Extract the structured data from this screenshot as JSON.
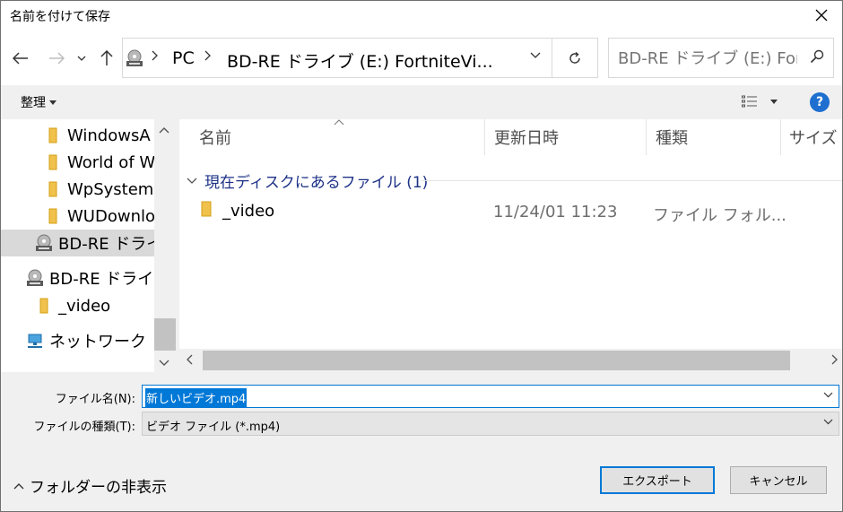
{
  "window": {
    "title": "名前を付けて保存"
  },
  "address": {
    "crumbs": [
      "PC",
      "BD-RE ドライブ (E:) FortniteVi..."
    ]
  },
  "search": {
    "placeholder": "BD-RE ドライブ (E:) Fort..."
  },
  "toolbar": {
    "organize_label": "整理"
  },
  "nav_tree": {
    "items": [
      {
        "label": "WindowsA",
        "icon": "folder-icon"
      },
      {
        "label": "World of W",
        "icon": "folder-icon"
      },
      {
        "label": "WpSystem",
        "icon": "folder-icon"
      },
      {
        "label": "WUDownlo",
        "icon": "folder-icon"
      },
      {
        "label": "BD-RE ドライブ",
        "icon": "bd-drive-icon",
        "selected": true
      },
      {
        "label": "BD-RE ドライブ",
        "icon": "bd-drive-icon"
      },
      {
        "label": "_video",
        "icon": "folder-icon"
      },
      {
        "label": "ネットワーク",
        "icon": "network-icon"
      }
    ]
  },
  "columns": {
    "name": "名前",
    "date": "更新日時",
    "type": "種類",
    "size": "サイズ"
  },
  "group": {
    "label": "現在ディスクにあるファイル (1)"
  },
  "files": [
    {
      "name": "_video",
      "date": "11/24/01 11:23",
      "type": "ファイル フォル..."
    }
  ],
  "form": {
    "filename_label": "ファイル名(N):",
    "filename_value": "新しいビデオ.mp4",
    "filetype_label": "ファイルの種類(T):",
    "filetype_value": "ビデオ ファイル (*.mp4)"
  },
  "footer": {
    "hide_folders_label": "フォルダーの非表示",
    "export_label": "エクスポート",
    "cancel_label": "キャンセル"
  },
  "colors": {
    "accent": "#0078d7",
    "help": "#1e6fd0",
    "group_text": "#1e3287"
  }
}
